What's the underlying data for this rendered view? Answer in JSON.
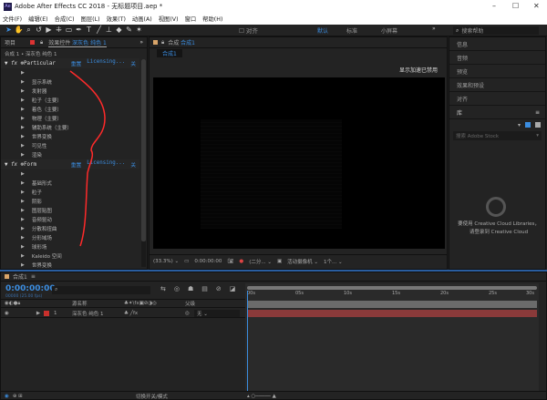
{
  "window": {
    "title": "Adobe After Effects CC 2018 - 无标题项目.aep *",
    "app_icon": "Ae",
    "minimize": "–",
    "maximize": "☐",
    "close": "✕"
  },
  "menu": [
    "文件(F)",
    "编辑(E)",
    "合成(C)",
    "图层(L)",
    "效果(T)",
    "动画(A)",
    "视图(V)",
    "窗口",
    "帮助(H)"
  ],
  "toolbar": {
    "tools": [
      "selection-icon",
      "hand-icon",
      "zoom-icon",
      "rotate-icon",
      "camera-icon",
      "pan-behind-icon",
      "rectangle-icon",
      "pen-icon",
      "text-icon",
      "brush-icon",
      "clone-stamp-icon",
      "eraser-icon",
      "roto-brush-icon",
      "puppet-pin-icon"
    ],
    "align_label": "对齐",
    "workspaces": [
      "默认",
      "标准",
      "小屏幕"
    ],
    "active_workspace": "默认",
    "more": "»",
    "search_placeholder": "搜索帮助"
  },
  "project_tab": "项目",
  "effect_controls": {
    "tab_prefix": "效果控件",
    "tab_layer": "深灰色 纯色 1",
    "more": "»",
    "breadcrumb": "合成 1 • 深灰色 纯色 1",
    "effects": [
      {
        "name": "Particular",
        "reset": "重置",
        "licensing": "Licensing...",
        "about": "关",
        "items": [
          "",
          "显示系统",
          "发射器",
          "粒子（主要）",
          "着色（主要）",
          "物理（主要）",
          "辅助系统（主要）",
          "世界变换",
          "可见性",
          "渲染"
        ]
      },
      {
        "name": "Form",
        "reset": "重置",
        "licensing": "Licensing...",
        "about": "关",
        "items": [
          "",
          "基础形式",
          "粒子",
          "阴影",
          "图层贴图",
          "音频驱动",
          "分散和扭曲",
          "分形域场",
          "球形场",
          "Kaleido 空间",
          "世界变换"
        ]
      }
    ]
  },
  "composition": {
    "tab_prefix": "合成",
    "tab_name": "合成1",
    "subtab": "合成1",
    "notice": "显示加速已禁用",
    "footer": {
      "zoom": "(33.3%)",
      "timecode": "0:00:00:00",
      "resolution": "(二分...",
      "camera": "活动摄像机",
      "views": "1个..."
    }
  },
  "right_panels": {
    "items": [
      "信息",
      "音频",
      "预览",
      "效果和预设",
      "对齐"
    ],
    "library": "库",
    "stock_search": "搜索 Adobe Stock",
    "cc_line1": "要使用 Creative Cloud Libraries，",
    "cc_line2": "请登录到 Creative Cloud"
  },
  "timeline": {
    "tab": "合成1",
    "timecode": "0:00:00:00",
    "fps": "00000 (25.00 fps)",
    "search_placeholder": "",
    "columns": {
      "source": "源名称",
      "parent": "父级"
    },
    "layers": [
      {
        "index": "1",
        "name": "深灰色 纯色 1",
        "parent": "无",
        "color": "#c9302c"
      }
    ],
    "ruler": [
      "00s",
      "05s",
      "10s",
      "15s",
      "20s",
      "25s",
      "30s"
    ],
    "footer": "切换开关/模式"
  },
  "colors": {
    "accent": "#3b8de0",
    "layer_bar": "#8a3a3a",
    "annotation": "#ff2a2a"
  }
}
